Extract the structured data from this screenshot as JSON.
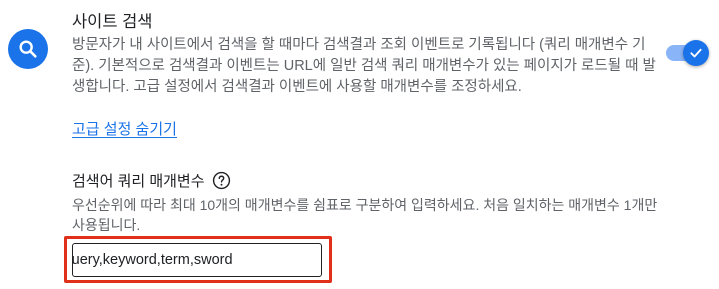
{
  "section": {
    "title": "사이트 검색",
    "description": "방문자가 내 사이트에서 검색을 할 때마다 검색결과 조회 이벤트로 기록됩니다 (쿼리 매개변수 기준). 기본적으로 검색결과 이벤트는 URL에 일반 검색 쿼리 매개변수가 있는 페이지가 로드될 때 발생합니다. 고급 설정에서 검색결과 이벤트에 사용할 매개변수를 조정하세요.",
    "icon": "search-icon",
    "toggle_on": true
  },
  "advanced": {
    "link_label": "고급 설정 숨기기"
  },
  "query_params": {
    "label": "검색어 쿼리 매개변수",
    "help_icon": "help-circle-icon",
    "description": "우선순위에 따라 최대 10개의 매개변수를 쉼표로 구분하여 입력하세요. 처음 일치하는 매개변수 1개만 사용됩니다.",
    "value": ",search,query,keyword,term,sword"
  },
  "colors": {
    "accent": "#1a73e8",
    "toggle_track": "#8ab4f8",
    "highlight": "#e03019"
  }
}
